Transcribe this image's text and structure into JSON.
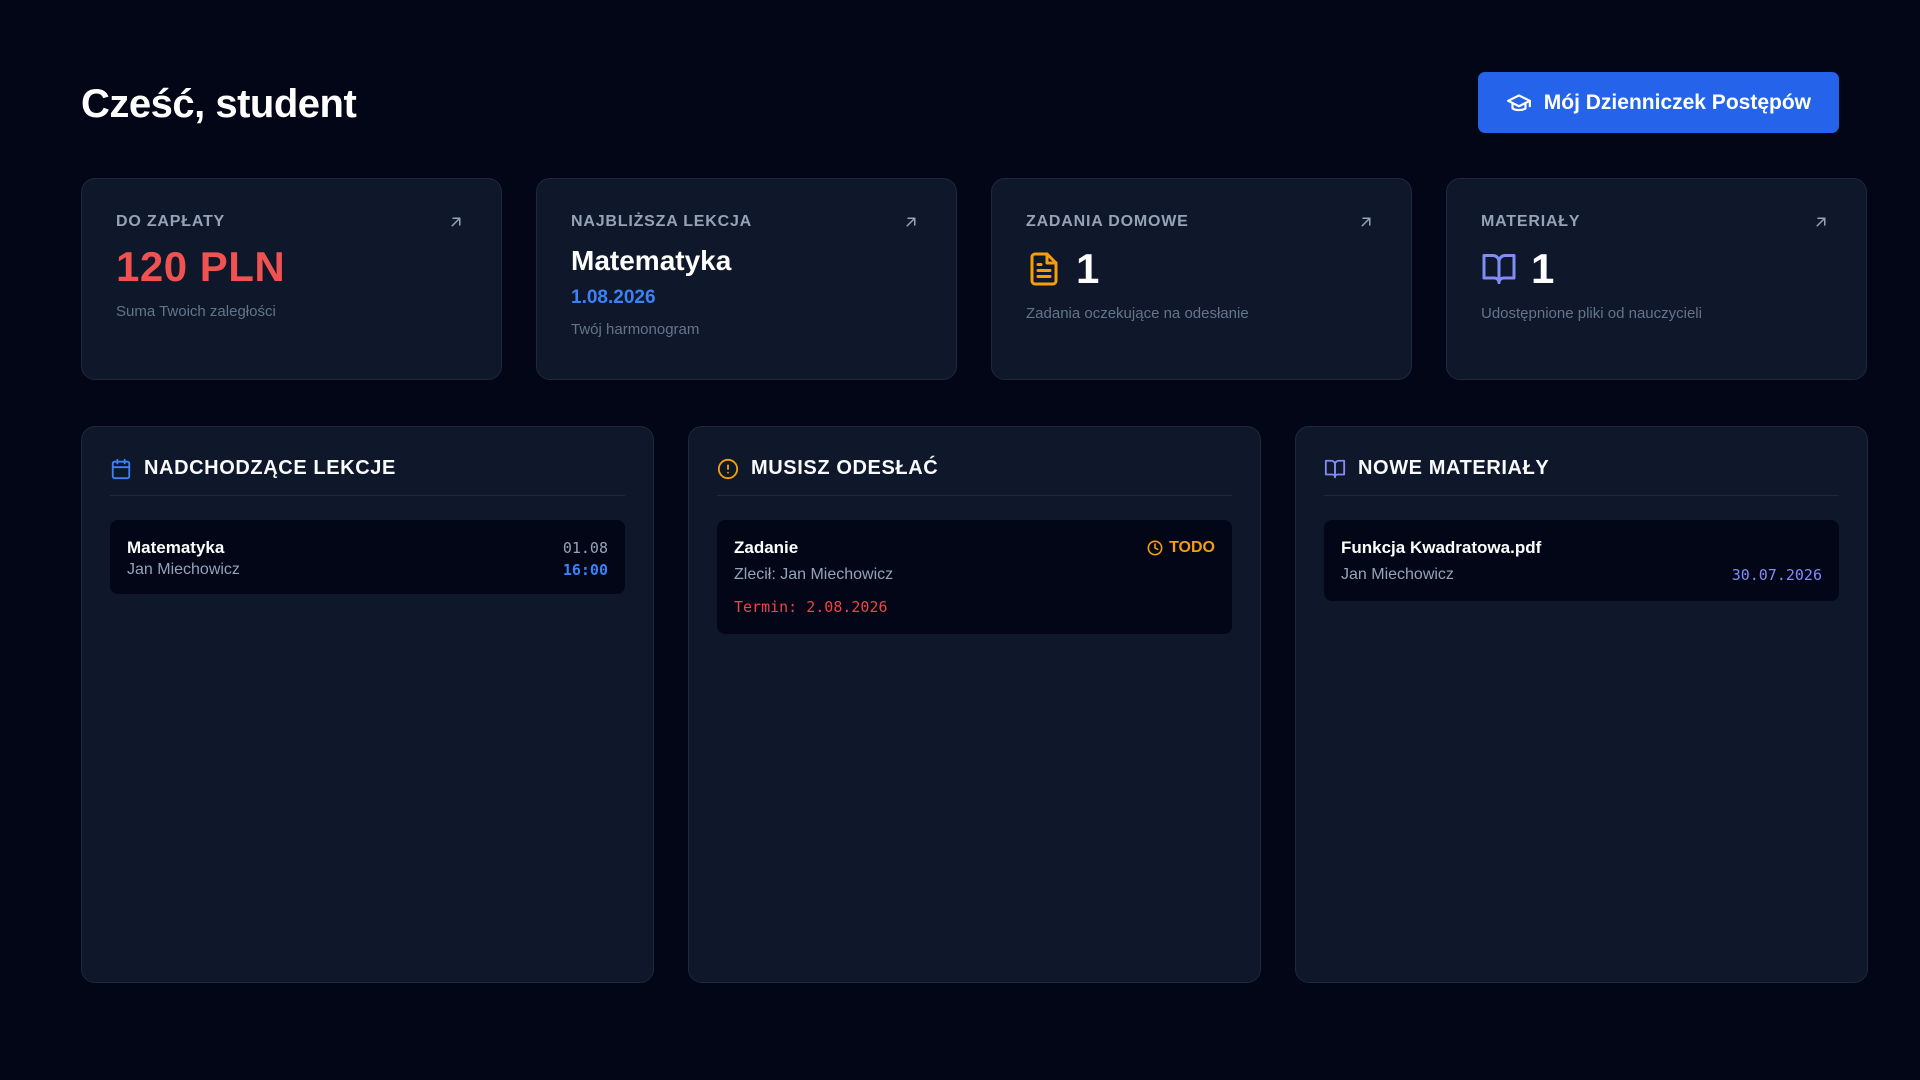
{
  "header": {
    "greeting": "Cześć, student",
    "cta_label": "Mój Dzienniczek Postępów"
  },
  "stats": {
    "payment": {
      "label": "DO ZAPŁATY",
      "value": "120 PLN",
      "description": "Suma Twoich zaległości"
    },
    "next_lesson": {
      "label": "NAJBLIŻSZA LEKCJA",
      "subject": "Matematyka",
      "date": "1.08.2026",
      "description": "Twój harmonogram"
    },
    "homework": {
      "label": "ZADANIA DOMOWE",
      "count": "1",
      "description": "Zadania oczekujące na odesłanie"
    },
    "materials": {
      "label": "MATERIAŁY",
      "count": "1",
      "description": "Udostępnione pliki od nauczycieli"
    }
  },
  "panels": {
    "upcoming": {
      "title": "NADCHODZĄCE LEKCJE",
      "items": [
        {
          "subject": "Matematyka",
          "teacher": "Jan Miechowicz",
          "date": "01.08",
          "time": "16:00"
        }
      ]
    },
    "to_submit": {
      "title": "MUSISZ ODESŁAĆ",
      "items": [
        {
          "title": "Zadanie",
          "status": "TODO",
          "assigned_by": "Zlecił: Jan Miechowicz",
          "deadline": "Termin: 2.08.2026"
        }
      ]
    },
    "new_materials": {
      "title": "NOWE MATERIAŁY",
      "items": [
        {
          "filename": "Funkcja Kwadratowa.pdf",
          "teacher": "Jan Miechowicz",
          "date": "30.07.2026"
        }
      ]
    }
  },
  "colors": {
    "background": "#020617",
    "card": "#0f172a",
    "accent_blue": "#2563eb",
    "danger": "#f05252",
    "warning": "#f59e0b",
    "indigo": "#818cf8"
  },
  "icons": {
    "cta": "graduation-cap-icon",
    "stat_link": "arrow-up-right-icon",
    "homework": "file-text-icon",
    "materials": "book-open-icon",
    "upcoming": "calendar-icon",
    "to_submit": "alert-circle-icon",
    "todo": "clock-icon",
    "new_materials": "book-open-icon"
  }
}
